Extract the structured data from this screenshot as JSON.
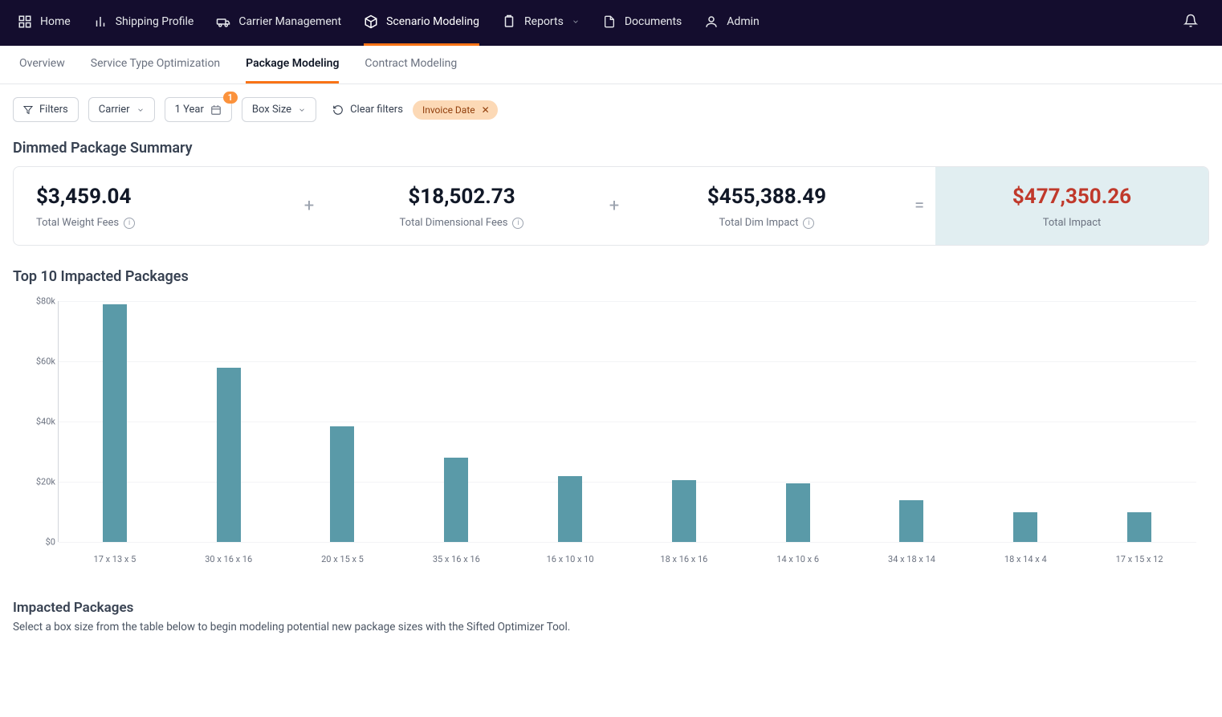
{
  "topnav": {
    "items": [
      {
        "label": "Home"
      },
      {
        "label": "Shipping Profile"
      },
      {
        "label": "Carrier Management"
      },
      {
        "label": "Scenario Modeling"
      },
      {
        "label": "Reports"
      },
      {
        "label": "Documents"
      },
      {
        "label": "Admin"
      }
    ]
  },
  "subtabs": [
    {
      "label": "Overview"
    },
    {
      "label": "Service Type Optimization"
    },
    {
      "label": "Package Modeling"
    },
    {
      "label": "Contract Modeling"
    }
  ],
  "filters": {
    "filters_label": "Filters",
    "carrier_label": "Carrier",
    "period_label": "1 Year",
    "period_badge": "1",
    "boxsize_label": "Box Size",
    "clear_label": "Clear filters",
    "chip_label": "Invoice Date"
  },
  "summary": {
    "title": "Dimmed Package Summary",
    "cells": [
      {
        "value": "$3,459.04",
        "label": "Total Weight Fees"
      },
      {
        "value": "$18,502.73",
        "label": "Total Dimensional Fees"
      },
      {
        "value": "$455,388.49",
        "label": "Total Dim Impact"
      },
      {
        "value": "$477,350.26",
        "label": "Total Impact"
      }
    ]
  },
  "chart_title": "Top 10 Impacted Packages",
  "chart_data": {
    "type": "bar",
    "title": "Top 10 Impacted Packages",
    "xlabel": "",
    "ylabel": "",
    "ylim": [
      0,
      80000
    ],
    "yticks": [
      0,
      20000,
      40000,
      60000,
      80000
    ],
    "ytick_labels": [
      "$0",
      "$20k",
      "$40k",
      "$60k",
      "$80k"
    ],
    "categories": [
      "17 x 13 x 5",
      "30 x 16 x 16",
      "20 x 15 x 5",
      "35 x 16 x 16",
      "16 x 10 x 10",
      "18 x 16 x 16",
      "14 x 10 x 6",
      "34 x 18 x 14",
      "18 x 14 x 4",
      "17 x 15 x 12"
    ],
    "values": [
      79000,
      58000,
      38500,
      28000,
      22000,
      20500,
      19500,
      14000,
      10000,
      10000
    ]
  },
  "impacted": {
    "title": "Impacted Packages",
    "desc": "Select a box size from the table below to begin modeling potential new package sizes with the Sifted Optimizer Tool."
  }
}
